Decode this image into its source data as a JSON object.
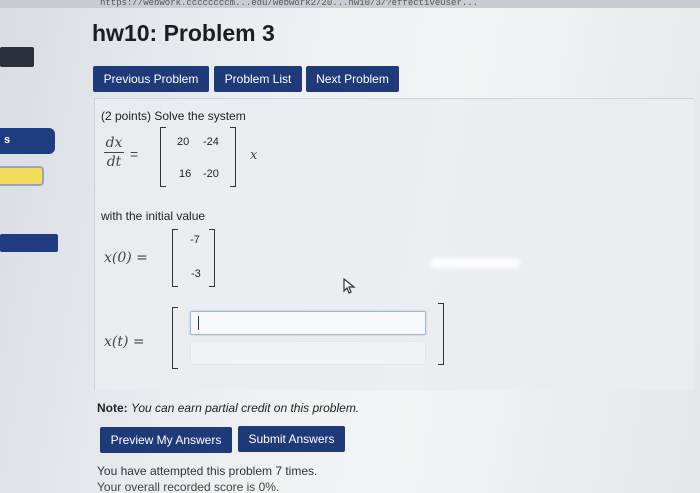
{
  "browser": {
    "url": "https://webwork.ccccccccm...edu/webwork2/20...hw10/3/?effectiveUser..."
  },
  "sidebar": {
    "item_label": "s"
  },
  "page": {
    "title": "hw10: Problem 3"
  },
  "nav": {
    "previous_label": "Previous Problem",
    "list_label": "Problem List",
    "next_label": "Next Problem"
  },
  "problem": {
    "intro": "(2 points) Solve the system",
    "dx": "dx",
    "dt": "dt",
    "equals": "=",
    "x_var": "x",
    "matrix": [
      [
        "20",
        "-24"
      ],
      [
        "16",
        "-20"
      ]
    ],
    "initial_text": "with the initial value",
    "x0_label": "x(0) =",
    "x0": [
      "-7",
      "-3"
    ],
    "xt_label": "x(t) ="
  },
  "note": {
    "bold": "Note:",
    "text": "You can earn partial credit on this problem."
  },
  "actions": {
    "preview_label": "Preview My Answers",
    "submit_label": "Submit Answers"
  },
  "status": {
    "attempts": "You have attempted this problem 7 times.",
    "score": "Your overall recorded score is 0%."
  },
  "colors": {
    "button": "#1f3a78",
    "sidebar_highlight": "#f3dc5a"
  }
}
